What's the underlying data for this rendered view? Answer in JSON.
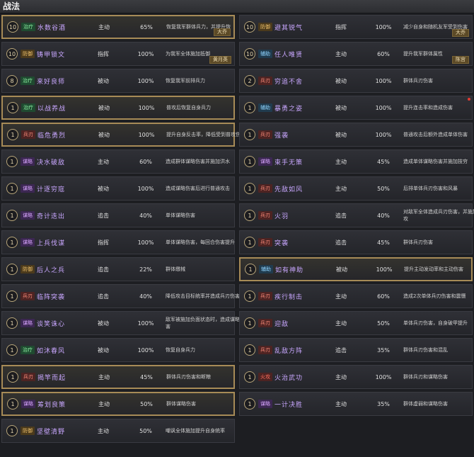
{
  "header": {
    "title": "战法"
  },
  "cards": [
    {
      "level": "10",
      "tag": "治疗",
      "tagType": "heal",
      "name": "水数谷酒",
      "type": "主动",
      "rate": "65%",
      "desc": "恢复我军群体兵力，并提升恢",
      "hero": "大乔",
      "gold": true
    },
    {
      "level": "10",
      "tag": "防御",
      "tagType": "def",
      "name": "避其锐气",
      "type": "指挥",
      "rate": "100%",
      "desc": "减少自身和随机友军受到伤害",
      "hero": "大乔",
      "gold": false
    },
    {
      "level": "10",
      "tag": "防御",
      "tagType": "def",
      "name": "铸甲锁文",
      "type": "指挥",
      "rate": "100%",
      "desc": "为我军全体施加抵御",
      "hero": "黄月英",
      "gold": false
    },
    {
      "level": "10",
      "tag": "辅助",
      "tagType": "aux",
      "name": "任人唯贤",
      "type": "主动",
      "rate": "60%",
      "desc": "提升我军群体属性",
      "hero": "陈宫",
      "gold": false
    },
    {
      "level": "8",
      "tag": "治疗",
      "tagType": "heal",
      "name": "来好良师",
      "type": "被动",
      "rate": "100%",
      "desc": "恢复我军前排兵力",
      "hero": "",
      "gold": false
    },
    {
      "level": "2",
      "tag": "兵刃",
      "tagType": "atk",
      "name": "穷追不舍",
      "type": "被动",
      "rate": "100%",
      "desc": "群体兵刃伤害",
      "hero": "",
      "gold": false
    },
    {
      "level": "1",
      "tag": "治疗",
      "tagType": "heal",
      "name": "以战养战",
      "type": "被动",
      "rate": "100%",
      "desc": "普攻后恢复自身兵力",
      "hero": "",
      "gold": true
    },
    {
      "level": "1",
      "tag": "辅助",
      "tagType": "aux",
      "name": "暴勇之姿",
      "type": "被动",
      "rate": "100%",
      "desc": "提升连击率和造成伤害",
      "hero": "",
      "gold": false,
      "dot": true
    },
    {
      "level": "1",
      "tag": "兵刃",
      "tagType": "atk",
      "name": "临危勇烈",
      "type": "被动",
      "rate": "100%",
      "desc": "提升自身反击率，降低受到普攻伤害",
      "hero": "",
      "gold": true
    },
    {
      "level": "1",
      "tag": "兵刃",
      "tagType": "atk",
      "name": "强袭",
      "type": "被动",
      "rate": "100%",
      "desc": "普通攻击后额外造成单体伤害",
      "hero": "",
      "gold": false
    },
    {
      "level": "1",
      "tag": "谋略",
      "tagType": "stra",
      "name": "决水破敌",
      "type": "主动",
      "rate": "60%",
      "desc": "造成群体谋略伤害并施加洪水",
      "hero": "",
      "gold": false
    },
    {
      "level": "1",
      "tag": "谋略",
      "tagType": "stra",
      "name": "束手无策",
      "type": "主动",
      "rate": "45%",
      "desc": "造成单体谋略伤害并施加技穷",
      "hero": "",
      "gold": false
    },
    {
      "level": "1",
      "tag": "谋略",
      "tagType": "stra",
      "name": "计逐穷寇",
      "type": "被动",
      "rate": "100%",
      "desc": "造成谋略伤害后进行普通攻击",
      "hero": "",
      "gold": false
    },
    {
      "level": "1",
      "tag": "兵刃",
      "tagType": "atk",
      "name": "先敌如风",
      "type": "主动",
      "rate": "50%",
      "desc": "后排单体兵刃伤害和风暴",
      "hero": "",
      "gold": false
    },
    {
      "level": "1",
      "tag": "谋略",
      "tagType": "stra",
      "name": "奇计迭出",
      "type": "追击",
      "rate": "40%",
      "desc": "单体谋略伤害",
      "hero": "",
      "gold": false
    },
    {
      "level": "1",
      "tag": "兵刃",
      "tagType": "atk",
      "name": "火羽",
      "type": "追击",
      "rate": "40%",
      "desc": "对敌军全体造成兵刃伤害，并施加火攻",
      "hero": "",
      "gold": false
    },
    {
      "level": "1",
      "tag": "谋略",
      "tagType": "stra",
      "name": "上兵伐谋",
      "type": "指挥",
      "rate": "100%",
      "desc": "单体谋略伤害，每回合伤害提升",
      "hero": "",
      "gold": false
    },
    {
      "level": "1",
      "tag": "兵刃",
      "tagType": "atk",
      "name": "突袭",
      "type": "追击",
      "rate": "45%",
      "desc": "群体兵刃伤害",
      "hero": "",
      "gold": false
    },
    {
      "level": "1",
      "tag": "防御",
      "tagType": "def",
      "name": "后人之兵",
      "type": "追击",
      "rate": "22%",
      "desc": "群体缴械",
      "hero": "",
      "gold": false
    },
    {
      "level": "1",
      "tag": "辅助",
      "tagType": "aux",
      "name": "如有神助",
      "type": "被动",
      "rate": "100%",
      "desc": "提升主动发动率和主动伤害",
      "hero": "",
      "gold": true
    },
    {
      "level": "1",
      "tag": "兵刃",
      "tagType": "atk",
      "name": "临阵突袭",
      "type": "追击",
      "rate": "40%",
      "desc": "降低攻击目标统率并造成兵刃伤害",
      "hero": "",
      "gold": false
    },
    {
      "level": "1",
      "tag": "兵刃",
      "tagType": "atk",
      "name": "疾行制击",
      "type": "主动",
      "rate": "60%",
      "desc": "造成2次单体兵刃伤害和震慑",
      "hero": "",
      "gold": false
    },
    {
      "level": "1",
      "tag": "谋略",
      "tagType": "stra",
      "name": "谈笑诛心",
      "type": "被动",
      "rate": "100%",
      "desc": "敌军被施加负面状态时，造成谋略伤害",
      "hero": "",
      "gold": false
    },
    {
      "level": "1",
      "tag": "兵刃",
      "tagType": "atk",
      "name": "迎敌",
      "type": "主动",
      "rate": "50%",
      "desc": "单体兵刃伤害，自身破甲提升",
      "hero": "",
      "gold": false
    },
    {
      "level": "1",
      "tag": "治疗",
      "tagType": "heal",
      "name": "如沐春风",
      "type": "被动",
      "rate": "100%",
      "desc": "恢复自身兵力",
      "hero": "",
      "gold": false
    },
    {
      "level": "1",
      "tag": "兵刃",
      "tagType": "atk",
      "name": "乱敌方阵",
      "type": "追击",
      "rate": "35%",
      "desc": "群体兵刃伤害和混乱",
      "hero": "",
      "gold": false
    },
    {
      "level": "1",
      "tag": "兵刃",
      "tagType": "atk",
      "name": "揭竿而起",
      "type": "主动",
      "rate": "45%",
      "desc": "群体兵刃伤害和断粮",
      "hero": "",
      "gold": true
    },
    {
      "level": "1",
      "tag": "火攻",
      "tagType": "fire",
      "name": "火治武功",
      "type": "主动",
      "rate": "100%",
      "desc": "群体兵刃和谋略伤害",
      "hero": "",
      "gold": false
    },
    {
      "level": "1",
      "tag": "谋略",
      "tagType": "stra",
      "name": "筹划良策",
      "type": "主动",
      "rate": "50%",
      "desc": "群体谋略伤害",
      "hero": "",
      "gold": true
    },
    {
      "level": "1",
      "tag": "谋略",
      "tagType": "stra",
      "name": "一计决胜",
      "type": "主动",
      "rate": "35%",
      "desc": "群体虚弱和谋略伤害",
      "hero": "",
      "gold": false
    },
    {
      "level": "1",
      "tag": "防御",
      "tagType": "def",
      "name": "坚壁清野",
      "type": "主动",
      "rate": "50%",
      "desc": "嘲讽全体施加提升自身统率",
      "hero": "",
      "gold": false
    }
  ]
}
